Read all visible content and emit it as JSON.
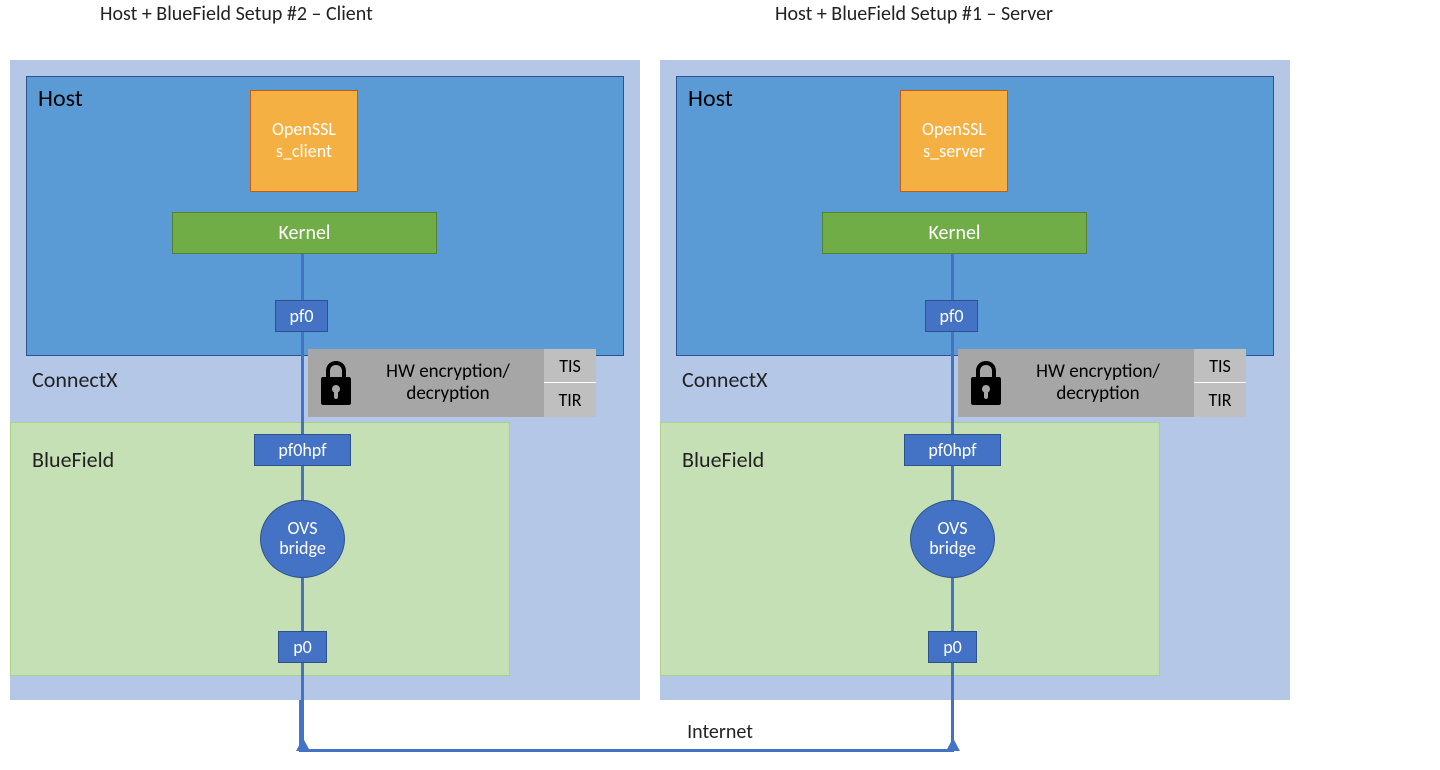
{
  "titles": {
    "client": "Host + BlueField Setup #2 – Client",
    "server": "Host + BlueField Setup #1 – Server"
  },
  "labels": {
    "host": "Host",
    "connectx": "ConnectX",
    "bluefield": "BlueField",
    "kernel": "Kernel",
    "pf0": "pf0",
    "pf0hpf": "pf0hpf",
    "p0": "p0",
    "ovs_top": "OVS",
    "ovs_bottom": "bridge",
    "hw_line1": "HW encryption/",
    "hw_line2": "decryption",
    "tis": "TIS",
    "tir": "TIR",
    "openssl_top": "OpenSSL",
    "openssl_client": "s_client",
    "openssl_server": "s_server",
    "internet": "Internet"
  }
}
